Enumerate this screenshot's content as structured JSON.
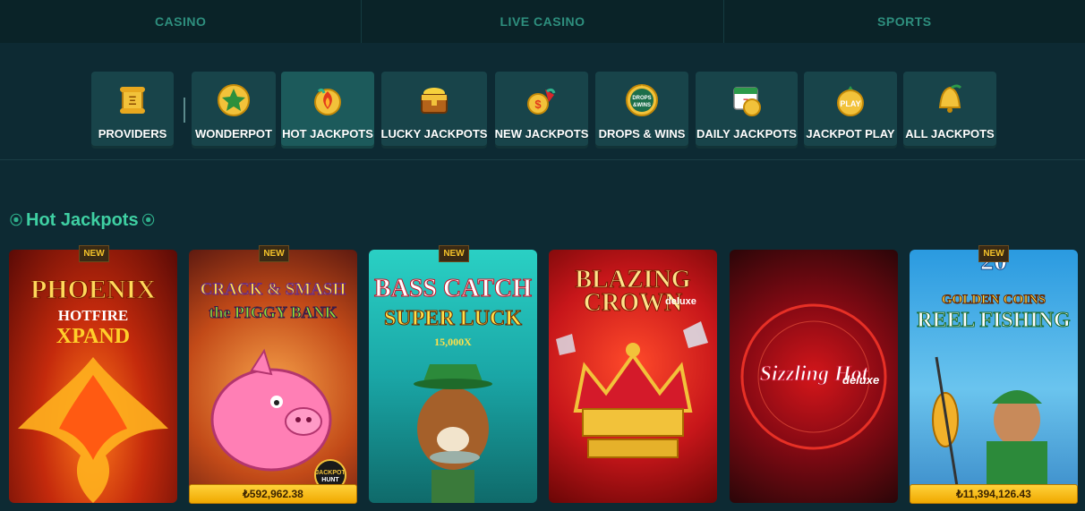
{
  "topnav": [
    "CASINO",
    "LIVE CASINO",
    "SPORTS"
  ],
  "categories": [
    {
      "label": "PROVIDERS",
      "icon": "scroll-icon"
    },
    {
      "label": "WONDERPOT",
      "icon": "star-icon"
    },
    {
      "label": "HOT JACKPOTS",
      "icon": "fire-coin-icon"
    },
    {
      "label": "LUCKY JACKPOTS",
      "icon": "treasure-chest-icon"
    },
    {
      "label": "NEW JACKPOTS",
      "icon": "coin-gift-icon"
    },
    {
      "label": "DROPS & WINS",
      "icon": "drops-wins-icon",
      "icon_text": "DROPS &WINS"
    },
    {
      "label": "DAILY JACKPOTS",
      "icon": "calendar-coin-icon"
    },
    {
      "label": "JACKPOT PLAY",
      "icon": "play-coin-icon",
      "icon_text": "PLAY"
    },
    {
      "label": "ALL JACKPOTS",
      "icon": "bell-icon"
    }
  ],
  "active_category": "HOT JACKPOTS",
  "section": {
    "title": "Hot Jackpots"
  },
  "new_label": "NEW",
  "games": [
    {
      "name": "PHOENIX",
      "line2": "HOTFIRE",
      "line3": "XPAND",
      "new": true
    },
    {
      "name": "CRACK & SMASH",
      "line2": "the PIGGY BANK",
      "badge": "JACKPOT HUNT",
      "jackpot": "₺592,962.38",
      "new": true
    },
    {
      "name": "BASS CATCH",
      "line2": "SUPER LUCK",
      "line3": "15,000X",
      "new": true
    },
    {
      "name": "BLAZING",
      "line2": "CROWN",
      "line3": "deluxe",
      "new": false
    },
    {
      "name": "Sizzling Hot",
      "line2": "deluxe",
      "new": false
    },
    {
      "name": "20",
      "line2": "GOLDEN COINS",
      "line3": "REEL FISHING",
      "jackpot": "₺11,394,126.43",
      "new": true
    }
  ]
}
